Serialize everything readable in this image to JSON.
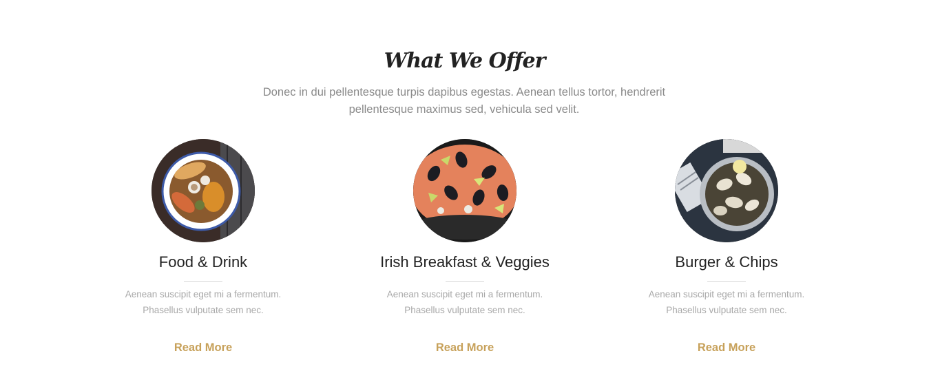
{
  "section": {
    "title": "What We Offer",
    "intro": "Donec in dui pellentesque turpis dapibus egestas. Aenean tellus tortor, hendrerit pellentesque maximus sed, vehicula sed velit."
  },
  "cards": [
    {
      "image": "seafood-soup-bowl-image",
      "title": "Food & Drink",
      "text": "Aenean suscipit eget mi a fermentum. Phasellus vulputate sem nec.",
      "link": "Read More"
    },
    {
      "image": "paella-pan-image",
      "title": "Irish Breakfast & Veggies",
      "text": "Aenean suscipit eget mi a fermentum. Phasellus vulputate sem nec.",
      "link": "Read More"
    },
    {
      "image": "clams-bowl-image",
      "title": "Burger & Chips",
      "text": "Aenean suscipit eget mi a fermentum. Phasellus vulputate sem nec.",
      "link": "Read More"
    }
  ],
  "colors": {
    "accent": "#c7a15a",
    "heading": "#222222",
    "body_text": "#8a8a8a",
    "muted_text": "#a8a8a8",
    "background": "#ffffff"
  }
}
